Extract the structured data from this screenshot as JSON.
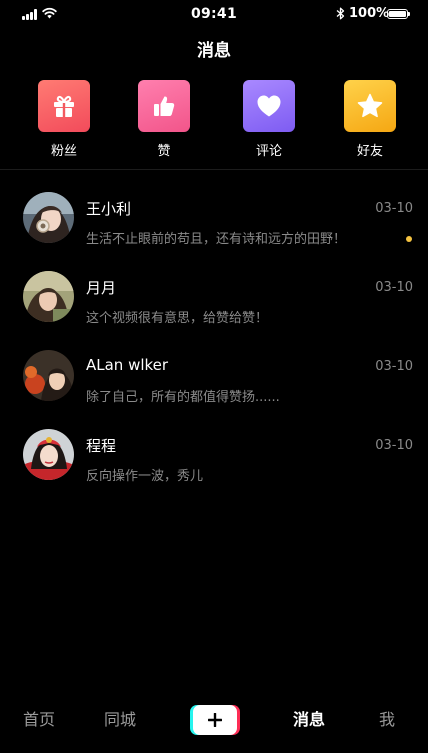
{
  "status_bar": {
    "time": "09:41",
    "battery": "100%"
  },
  "header": {
    "title": "消息"
  },
  "categories": [
    {
      "label": "粉丝",
      "icon": "gift-icon",
      "color_from": "#ff7b73",
      "color_to": "#f24b5b"
    },
    {
      "label": "赞",
      "icon": "thumbs-up-icon",
      "color_from": "#ff7fae",
      "color_to": "#f2558a"
    },
    {
      "label": "评论",
      "icon": "heart-icon",
      "color_from": "#a989ff",
      "color_to": "#7e5cf2"
    },
    {
      "label": "好友",
      "icon": "star-icon",
      "color_from": "#ffd24a",
      "color_to": "#f5a713"
    }
  ],
  "messages": [
    {
      "name": "王小利",
      "preview": "生活不止眼前的苟且，还有诗和远方的田野！",
      "date": "03-10",
      "unread": true
    },
    {
      "name": "月月",
      "preview": "这个视频很有意思，给赞给赞！",
      "date": "03-10",
      "unread": false
    },
    {
      "name": "ALan wlker",
      "preview": "除了自己，所有的都值得赞扬......",
      "date": "03-10",
      "unread": false
    },
    {
      "name": "程程",
      "preview": "反向操作一波，秀儿",
      "date": "03-10",
      "unread": false
    }
  ],
  "tabbar": {
    "home": "首页",
    "local": "同城",
    "create": "+",
    "messages": "消息",
    "me": "我"
  },
  "colors": {
    "background": "#000000",
    "secondary_text": "#8a8a8a",
    "unread_dot": "#f5c341",
    "brand_cyan": "#25f4ee",
    "brand_red": "#fe2c55"
  }
}
